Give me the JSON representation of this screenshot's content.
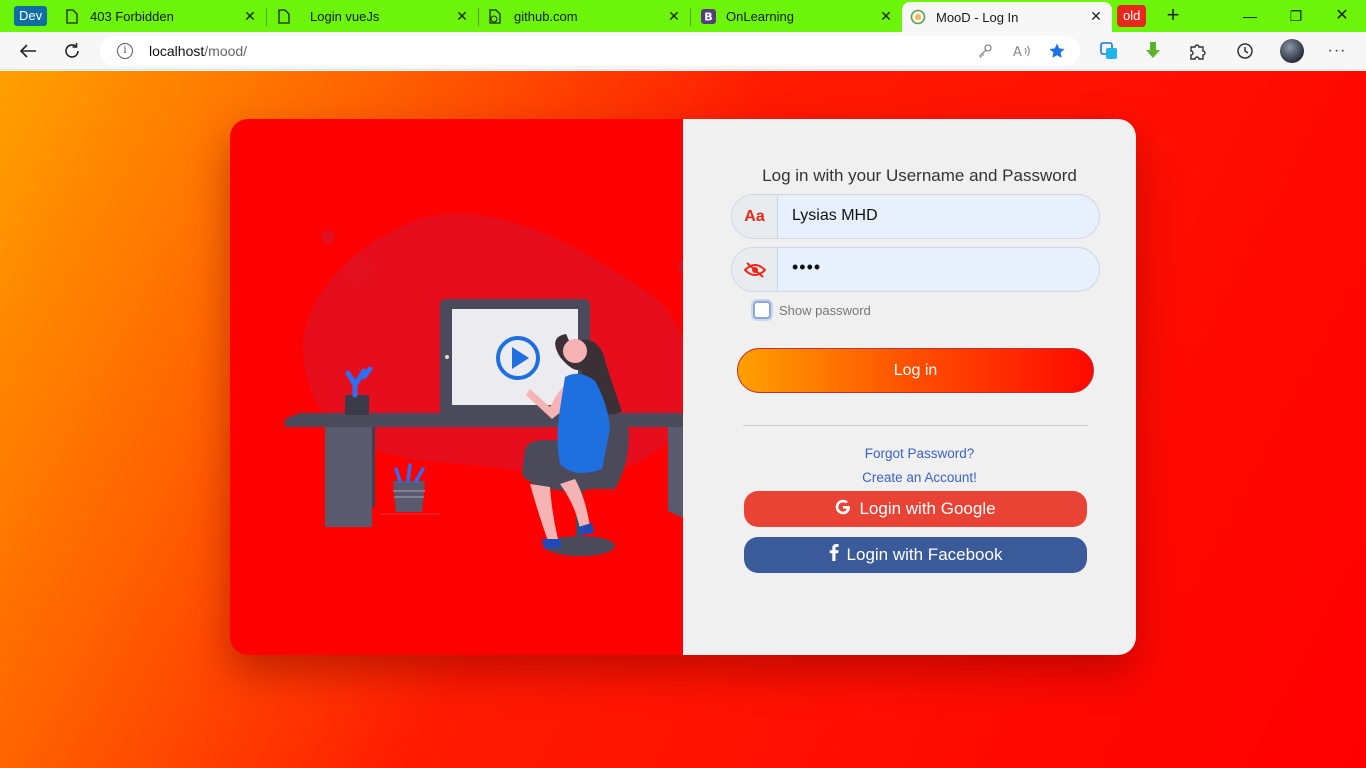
{
  "browser": {
    "dev_badge": "Dev",
    "tabs": [
      {
        "title": "403 Forbidden",
        "icon": "page-icon"
      },
      {
        "title": "Login vueJs",
        "icon": "page-icon"
      },
      {
        "title": "github.com",
        "icon": "github-page-icon"
      },
      {
        "title": "OnLearning",
        "icon": "bootstrap-icon"
      },
      {
        "title": "MooD - Log In",
        "icon": "mood-icon",
        "active": true
      }
    ],
    "old_badge": "old",
    "address": {
      "host": "localhost",
      "path": "/mood/"
    }
  },
  "login": {
    "heading": "Log in with your Username and Password",
    "username_prefix": "Aa",
    "username_value": "Lysias MHD",
    "password_value": "••••",
    "show_password_label": "Show password",
    "login_button": "Log in",
    "forgot_password": "Forgot Password?",
    "create_account": "Create an Account!",
    "google_button": "Login with Google",
    "facebook_button": "Login with Facebook"
  },
  "colors": {
    "tabbar": "#6cf50a",
    "card_left": "#ff0000",
    "card_right": "#f0f0f0",
    "google": "#e94335",
    "facebook": "#3a5a9a",
    "link": "#3a62c9"
  }
}
